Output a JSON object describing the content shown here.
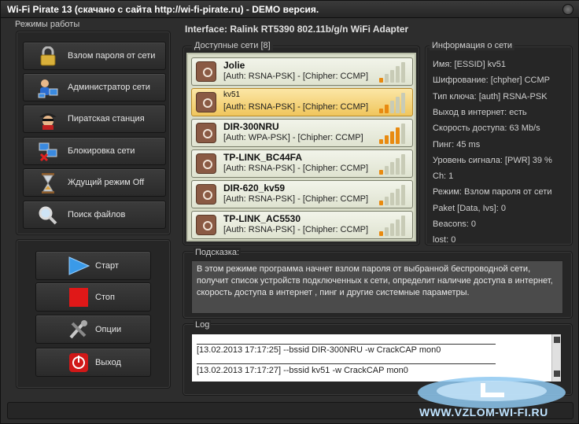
{
  "window": {
    "title": "Wi-Fi Pirate 13 (скачано с сайта http://wi-fi-pirate.ru) - DEMO версия."
  },
  "interface": "Interface:  Ralink RT5390 802.11b/g/n WiFi Adapter",
  "modes": {
    "heading": "Режимы работы",
    "items": [
      {
        "label": "Взлом пароля от сети",
        "icon": "padlock-icon"
      },
      {
        "label": "Администратор сети",
        "icon": "admin-network-icon"
      },
      {
        "label": "Пиратская станция",
        "icon": "pirate-icon"
      },
      {
        "label": "Блокировка сети",
        "icon": "network-block-icon"
      },
      {
        "label": "Ждущий режим Off",
        "icon": "hourglass-icon"
      },
      {
        "label": "Поиск файлов",
        "icon": "magnifier-icon"
      }
    ]
  },
  "actions": {
    "start": "Старт",
    "stop": "Стоп",
    "options": "Опции",
    "exit": "Выход"
  },
  "networks": {
    "heading": "Доступные сети [8]",
    "items": [
      {
        "ssid": "Jolie",
        "security": "[Auth: RSNA-PSK] - [Chipher: CCMP]",
        "signal": 1,
        "selected": false
      },
      {
        "ssid": "kv51",
        "security": "[Auth: RSNA-PSK] - [Chipher: CCMP]",
        "signal": 2,
        "selected": true
      },
      {
        "ssid": "DIR-300NRU",
        "security": "[Auth: WPA-PSK] - [Chipher: CCMP]",
        "signal": 4,
        "selected": false
      },
      {
        "ssid": "TP-LINK_BC44FA",
        "security": "[Auth: RSNA-PSK] - [Chipher: CCMP]",
        "signal": 1,
        "selected": false
      },
      {
        "ssid": "DIR-620_kv59",
        "security": "[Auth: RSNA-PSK] - [Chipher: CCMP]",
        "signal": 1,
        "selected": false
      },
      {
        "ssid": "TP-LINK_AC5530",
        "security": "[Auth: RSNA-PSK] - [Chipher: CCMP]",
        "signal": 1,
        "selected": false
      }
    ]
  },
  "info": {
    "heading": "Информация о сети",
    "rows": [
      "Имя: [ESSID]  kv51",
      "Шифрование: [chpher]   CCMP",
      "Тип ключа: [auth]   RSNA-PSK",
      "Выход в интернет:  есть",
      "Скорость доступа:  63 Mb/s",
      "Пинг:  45 ms",
      "Уровень сигнала: [PWR]  39 %",
      "Ch:  1",
      "Режим:  Взлом пароля от сети",
      "Paket [Data, Ivs]:  0",
      "Beacons:  0",
      "lost:  0"
    ]
  },
  "hint": {
    "heading": "Подсказка:",
    "text": "В этом режиме программа начнет взлом пароля от выбранной беспроводной сети, получит список устройств подключенных к сети, определит наличие доступа в интернет, скорость доступа в интернет , пинг и другие системные параметры."
  },
  "log": {
    "heading": "Log",
    "lines": [
      "[13.02.2013 17:17:25]  --bssid DIR-300NRU -w CrackCAP mon0",
      "[13.02.2013 17:17:27]  --bssid kv51 -w CrackCAP mon0"
    ]
  },
  "watermark": "WWW.VZLOM-WI-FI.RU",
  "colors": {
    "signal_on": "#e88a10",
    "selected_row": "#f0c65c",
    "list_bg": "#d8dcc8"
  }
}
